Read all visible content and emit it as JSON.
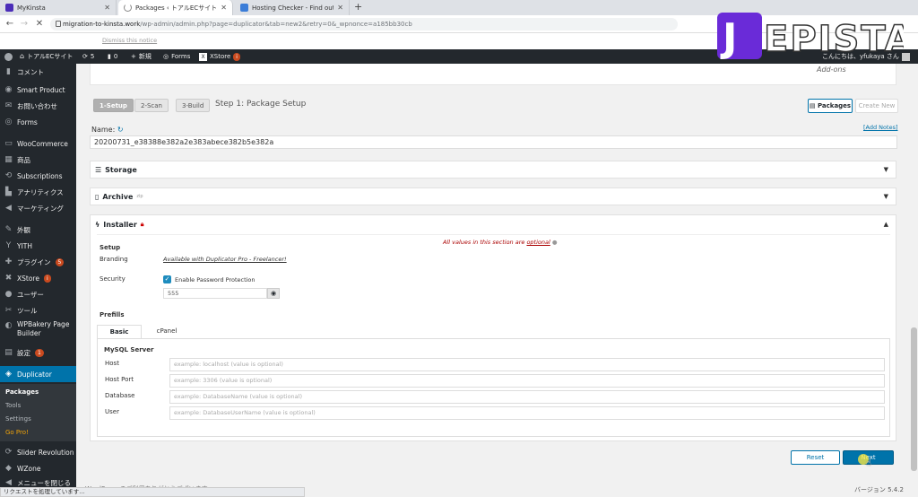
{
  "browser": {
    "tabs": [
      {
        "label": "MyKinsta",
        "icon": "kinsta-icon"
      },
      {
        "label": "Packages ‹ トアルECサイト — Word",
        "icon": "loading-icon"
      },
      {
        "label": "Hosting Checker - Find out who",
        "icon": "hosting-checker-icon"
      }
    ],
    "new_tab": "+",
    "url_host": "migration-to-kinsta.work",
    "url_path": "/wp-admin/admin.php?page=duplicator&tab=new2&retry=0&_wpnonce=a185bb30cb"
  },
  "admin_bar": {
    "site_name": "トアルECサイト",
    "updates": "5",
    "comments": "0",
    "new_label": "新規",
    "forms_label": "Forms",
    "xstore_label": "XStore",
    "xstore_badge": "i",
    "greeting": "こんにちは、yfukaya さん"
  },
  "sidebar": {
    "items": [
      {
        "label": "コメント",
        "icon": "comment-icon"
      },
      {
        "label": "Smart Product",
        "icon": "eye-icon"
      },
      {
        "label": "お問い合わせ",
        "icon": "mail-icon"
      },
      {
        "label": "Forms",
        "icon": "forms-icon"
      },
      {
        "label": "WooCommerce",
        "icon": "woocommerce-icon"
      },
      {
        "label": "商品",
        "icon": "products-icon"
      },
      {
        "label": "Subscriptions",
        "icon": "subscriptions-icon"
      },
      {
        "label": "アナリティクス",
        "icon": "analytics-icon"
      },
      {
        "label": "マーケティング",
        "icon": "marketing-icon"
      },
      {
        "label": "外観",
        "icon": "appearance-icon"
      },
      {
        "label": "YITH",
        "icon": "yith-icon"
      },
      {
        "label": "プラグイン",
        "icon": "plugins-icon",
        "badge": "5"
      },
      {
        "label": "XStore",
        "icon": "xstore-icon",
        "badge": "i"
      },
      {
        "label": "ユーザー",
        "icon": "users-icon"
      },
      {
        "label": "ツール",
        "icon": "tools-icon"
      },
      {
        "label": "WPBakery Page Builder",
        "icon": "wpbakery-icon"
      },
      {
        "label": "設定",
        "icon": "settings-icon",
        "badge": "1"
      },
      {
        "label": "Duplicator",
        "icon": "duplicator-icon"
      },
      {
        "label": "Slider Revolution",
        "icon": "slider-icon"
      },
      {
        "label": "WZone",
        "icon": "wzone-icon"
      },
      {
        "label": "メニューを閉じる",
        "icon": "collapse-icon"
      }
    ],
    "submenu": [
      "Packages",
      "Tools",
      "Settings",
      "Go Pro!"
    ]
  },
  "notice": {
    "dismiss": "Dismiss this notice",
    "addons": "Add-ons"
  },
  "steps": {
    "step1": "1-Setup",
    "step2": "2-Scan",
    "step3": "3-Build",
    "heading": "Step 1: Package Setup"
  },
  "top_buttons": {
    "packages": "Packages",
    "create_new": "Create New"
  },
  "name_field": {
    "label": "Name:",
    "value": "20200731_e38388e382a2e383abece382b5e382a",
    "add_notes": "[Add Notes]"
  },
  "panels": {
    "storage": "Storage",
    "archive": "Archive",
    "archive_sup": "zip",
    "installer": "Installer"
  },
  "installer": {
    "all_values_pre": "All values in this section are ",
    "all_values_link": "optional",
    "setup_label": "Setup",
    "branding_label": "Branding",
    "branding_value": "Available with Duplicator Pro - Freelancer!",
    "security_label": "Security",
    "password_checkbox": "Enable Password Protection",
    "password_value": "555",
    "prefills_label": "Prefills",
    "tabs": [
      "Basic",
      "cPanel"
    ],
    "mysql_title": "MySQL Server",
    "fields": [
      {
        "label": "Host",
        "placeholder": "example: localhost (value is optional)"
      },
      {
        "label": "Host Port",
        "placeholder": "example: 3306 (value is optional)"
      },
      {
        "label": "Database",
        "placeholder": "example: DatabaseName (value is optional)"
      },
      {
        "label": "User",
        "placeholder": "example: DatabaseUserName (value is optional)"
      }
    ]
  },
  "actions": {
    "reset": "Reset",
    "next": "Next"
  },
  "footer": {
    "thanks": "WordPress のご利用ありがとうございます。",
    "version": "バージョン 5.4.2",
    "status": "リクエストを処理しています..."
  },
  "logo_text": "JEPISTA"
}
